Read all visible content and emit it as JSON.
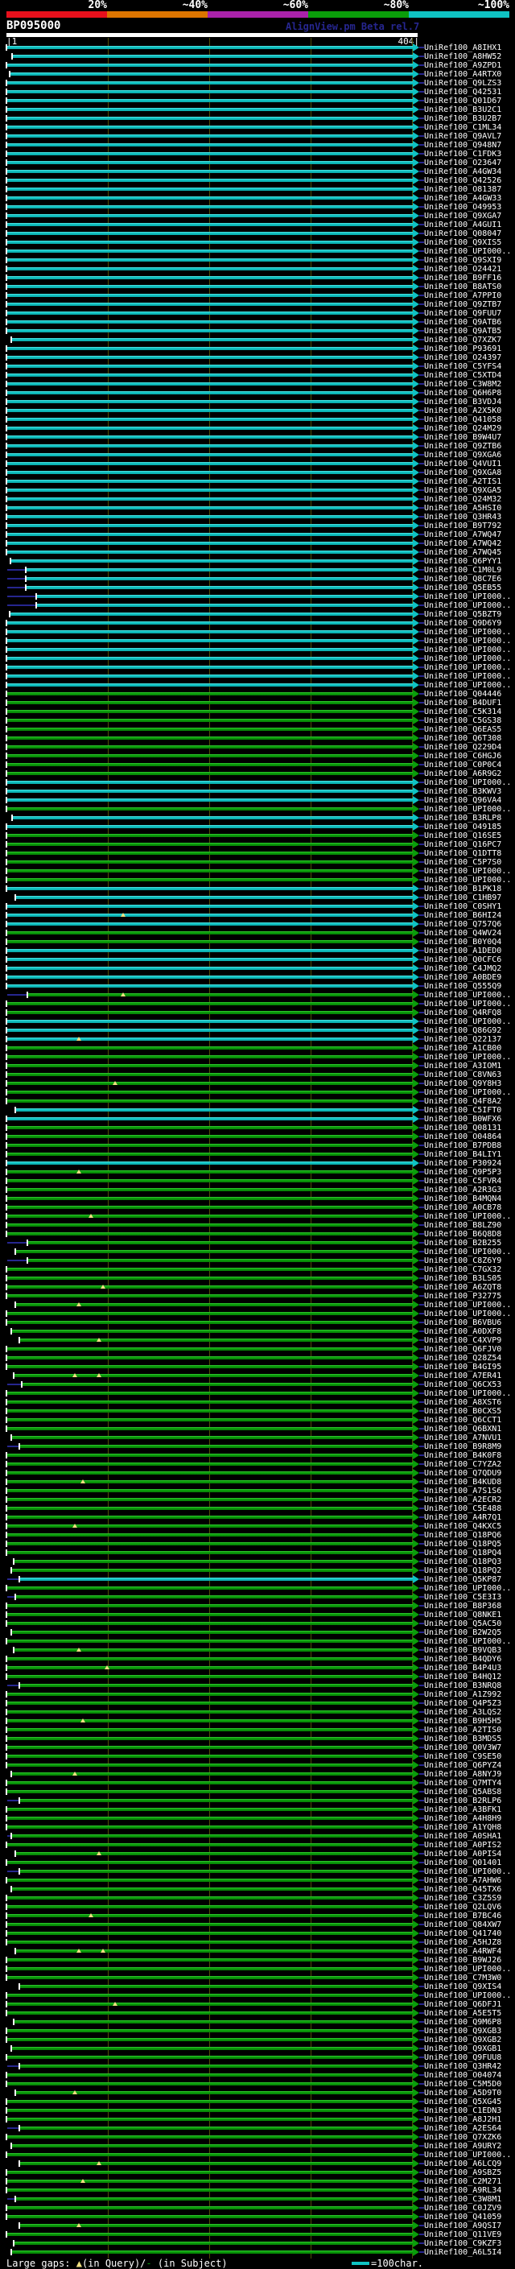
{
  "header": {
    "watermark": "AlignView.pm Beta rel.7",
    "key": {
      "labels": [
        "20%",
        "~40%",
        "~60%",
        "~80%",
        "~100%"
      ],
      "colors": [
        "#e8101c",
        "#dd7500",
        "#aa22aa",
        "#0a9e0a",
        "#0fc3c3"
      ]
    }
  },
  "legend": {
    "prefix": "Large gaps: ",
    "gap_query_symbol": "▲",
    "mid": "(in Query)/",
    "gap_subject_symbol": "-",
    "suffix": " (in Subject)",
    "scale_note": "=100char."
  },
  "colors": {
    "cyan": "#0fc3c3",
    "green": "#0a9e0a",
    "navy": "#26268f",
    "grid": "#4f4f08",
    "gap_marker": "#f0e080",
    "text": "#ffffff"
  },
  "label_prefix": "UniRef100_",
  "chart_data": {
    "type": "table",
    "title": "BP095000",
    "x_axis": {
      "start_label": "1",
      "end_label": "404",
      "tick_interval_chars": 100
    },
    "identity_key": {
      "bins": [
        "20%",
        "~40%",
        "~60%",
        "~80%",
        "~100%"
      ],
      "bin_colors": [
        "#e8101c",
        "#dd7500",
        "#aa22aa",
        "#0a9e0a",
        "#0fc3c3"
      ]
    },
    "row_format": "[uniref_id_suffix, identity_color(c=~100% cyan | g=~80% green), bar_start_px(default 9), navy_lead(1=subject extension line), gap_marker_x_px[]]",
    "rows": [
      [
        "A8IHX1",
        "c"
      ],
      [
        "A8HW52",
        "c",
        16
      ],
      [
        "A9ZPD1",
        "c"
      ],
      [
        "A4RTX0",
        "c",
        13
      ],
      [
        "Q9LZS3",
        "c"
      ],
      [
        "Q42531",
        "c"
      ],
      [
        "Q01D67",
        "c"
      ],
      [
        "B3U2C1",
        "c"
      ],
      [
        "B3U2B7",
        "c"
      ],
      [
        "C1ML34",
        "c"
      ],
      [
        "Q9AVL7",
        "c"
      ],
      [
        "Q948N7",
        "c"
      ],
      [
        "C1FDK3",
        "c"
      ],
      [
        "O23647",
        "c"
      ],
      [
        "A4GW34",
        "c"
      ],
      [
        "Q42526",
        "c"
      ],
      [
        "O81387",
        "c"
      ],
      [
        "A4GW33",
        "c"
      ],
      [
        "O49953",
        "c"
      ],
      [
        "Q9XGA7",
        "c"
      ],
      [
        "A4GUI1",
        "c"
      ],
      [
        "Q08047",
        "c"
      ],
      [
        "Q9XIS5",
        "c"
      ],
      [
        "UPI000..",
        "c"
      ],
      [
        "Q9SXI9",
        "c"
      ],
      [
        "O24421",
        "c"
      ],
      [
        "B9FF16",
        "c"
      ],
      [
        "B8ATS0",
        "c"
      ],
      [
        "A7PPI0",
        "c"
      ],
      [
        "Q9ZTB7",
        "c"
      ],
      [
        "Q9FUU7",
        "c"
      ],
      [
        "Q9ATB6",
        "c"
      ],
      [
        "Q9ATB5",
        "c"
      ],
      [
        "Q7XZK7",
        "c",
        15
      ],
      [
        "P93691",
        "c"
      ],
      [
        "O24397",
        "c"
      ],
      [
        "C5YFS4",
        "c"
      ],
      [
        "C5XTD4",
        "c"
      ],
      [
        "C3W8M2",
        "c"
      ],
      [
        "Q6H6P8",
        "c"
      ],
      [
        "B3VDJ4",
        "c"
      ],
      [
        "A2X5K0",
        "c"
      ],
      [
        "Q41058",
        "c"
      ],
      [
        "Q24M29",
        "c"
      ],
      [
        "B9W4U7",
        "c"
      ],
      [
        "Q9ZTB6",
        "c"
      ],
      [
        "Q9XGA6",
        "c"
      ],
      [
        "Q4VUI1",
        "c"
      ],
      [
        "Q9XGA8",
        "c"
      ],
      [
        "A2TIS1",
        "c"
      ],
      [
        "Q9XGA5",
        "c"
      ],
      [
        "Q24M32",
        "c"
      ],
      [
        "A5HSI0",
        "c"
      ],
      [
        "Q3HR43",
        "c"
      ],
      [
        "B9T792",
        "c"
      ],
      [
        "A7WQ47",
        "c"
      ],
      [
        "A7WQ42",
        "c"
      ],
      [
        "A7WQ45",
        "c"
      ],
      [
        "Q6PYY1",
        "c",
        14
      ],
      [
        "C1M0L9",
        "c",
        33,
        1
      ],
      [
        "Q8C7E6",
        "c",
        33,
        1
      ],
      [
        "Q5EB55",
        "c",
        33,
        1
      ],
      [
        "UPI000..",
        "c",
        46,
        1
      ],
      [
        "UPI000..",
        "c",
        46,
        1
      ],
      [
        "Q5BZT9",
        "c",
        13
      ],
      [
        "Q9D6Y9",
        "c"
      ],
      [
        "UPI000..",
        "c"
      ],
      [
        "UPI000..",
        "c"
      ],
      [
        "UPI000..",
        "c"
      ],
      [
        "UPI000..",
        "c"
      ],
      [
        "UPI000..",
        "c"
      ],
      [
        "UPI000..",
        "c"
      ],
      [
        "UPI000..",
        "c"
      ],
      [
        "Q04446",
        "g"
      ],
      [
        "B4DUF1",
        "g"
      ],
      [
        "C5K314",
        "g"
      ],
      [
        "C5GS38",
        "g"
      ],
      [
        "Q6EAS5",
        "g"
      ],
      [
        "Q6T308",
        "g"
      ],
      [
        "Q229D4",
        "g"
      ],
      [
        "C6HGJ6",
        "g"
      ],
      [
        "C0P0C4",
        "g"
      ],
      [
        "A6R9G2",
        "g"
      ],
      [
        "UPI000..",
        "c"
      ],
      [
        "B3KWV3",
        "c"
      ],
      [
        "Q96VA4",
        "c"
      ],
      [
        "UPI000..",
        "g"
      ],
      [
        "B3RLP8",
        "c",
        16
      ],
      [
        "O49185",
        "c"
      ],
      [
        "Q16SE5",
        "g"
      ],
      [
        "Q16PC7",
        "g"
      ],
      [
        "Q1DTT8",
        "g"
      ],
      [
        "C5P7S0",
        "g"
      ],
      [
        "UPI000..",
        "g"
      ],
      [
        "UPI000..",
        "g"
      ],
      [
        "B1PK18",
        "c"
      ],
      [
        "C1HB97",
        "c",
        20
      ],
      [
        "C0SHY1",
        "c"
      ],
      [
        "B6HI24",
        "c",
        9,
        0,
        [
          150
        ]
      ],
      [
        "Q757Q6",
        "c"
      ],
      [
        "Q4WV24",
        "g"
      ],
      [
        "B0Y0Q4",
        "g"
      ],
      [
        "A1DED0",
        "c"
      ],
      [
        "Q0CFC6",
        "c"
      ],
      [
        "C4JMQ2",
        "c"
      ],
      [
        "A0BDE9",
        "c"
      ],
      [
        "Q555Q9",
        "c"
      ],
      [
        "UPI000..",
        "g",
        35,
        1,
        [
          150
        ]
      ],
      [
        "UPI000..",
        "g"
      ],
      [
        "Q4RFQ8",
        "g"
      ],
      [
        "UPI000..",
        "c"
      ],
      [
        "Q86G92",
        "c"
      ],
      [
        "Q22137",
        "c",
        9,
        0,
        [
          95
        ]
      ],
      [
        "A1CB00",
        "g"
      ],
      [
        "UPI000..",
        "g"
      ],
      [
        "A3IOM1",
        "g"
      ],
      [
        "C8VN63",
        "g"
      ],
      [
        "Q9Y8H3",
        "g",
        9,
        0,
        [
          140
        ]
      ],
      [
        "UPI000..",
        "g"
      ],
      [
        "Q4F8A2",
        "g"
      ],
      [
        "C5IFT0",
        "c",
        20
      ],
      [
        "B0WFX6",
        "c"
      ],
      [
        "Q08131",
        "g"
      ],
      [
        "O04864",
        "g"
      ],
      [
        "B7PDB8",
        "g"
      ],
      [
        "B4LIY1",
        "g"
      ],
      [
        "P30924",
        "c"
      ],
      [
        "Q9P5P3",
        "g",
        9,
        0,
        [
          95
        ]
      ],
      [
        "C5FVR4",
        "g"
      ],
      [
        "A2R3G3",
        "g"
      ],
      [
        "B4MQN4",
        "g"
      ],
      [
        "A0CB78",
        "g"
      ],
      [
        "UPI000..",
        "g",
        9,
        0,
        [
          110
        ]
      ],
      [
        "B8LZ90",
        "g"
      ],
      [
        "B6Q8D8",
        "g"
      ],
      [
        "B2B255",
        "g",
        35,
        1
      ],
      [
        "UPI000..",
        "g",
        20
      ],
      [
        "C8Z6Y9",
        "g",
        35,
        1
      ],
      [
        "C7GX32",
        "g"
      ],
      [
        "B3LS05",
        "g"
      ],
      [
        "A6ZQT8",
        "g",
        9,
        0,
        [
          125
        ]
      ],
      [
        "P32775",
        "g"
      ],
      [
        "UPI000..",
        "g",
        20,
        0,
        [
          95
        ]
      ],
      [
        "UPI000..",
        "g"
      ],
      [
        "B6VBU6",
        "g"
      ],
      [
        "A0DXF8",
        "g",
        15
      ],
      [
        "C4XVP9",
        "g",
        25,
        0,
        [
          120
        ]
      ],
      [
        "Q6FJV0",
        "g"
      ],
      [
        "Q28Z54",
        "g"
      ],
      [
        "B4GI95",
        "g"
      ],
      [
        "A7ER41",
        "g",
        18,
        0,
        [
          90,
          120
        ]
      ],
      [
        "Q6CX53",
        "g",
        28,
        1
      ],
      [
        "UPI000..",
        "g"
      ],
      [
        "A8XST6",
        "g"
      ],
      [
        "B0CXS5",
        "g"
      ],
      [
        "Q6CCT1",
        "g"
      ],
      [
        "Q6BXN1",
        "g"
      ],
      [
        "A7NVU1",
        "g",
        15
      ],
      [
        "B9R8M9",
        "g",
        25,
        1
      ],
      [
        "B4K0F8",
        "g"
      ],
      [
        "C7YZA2",
        "g"
      ],
      [
        "Q7QDU9",
        "g"
      ],
      [
        "B4KUD8",
        "g",
        9,
        0,
        [
          100
        ]
      ],
      [
        "A7S1S6",
        "g"
      ],
      [
        "A2ECR2",
        "g"
      ],
      [
        "C5E488",
        "g"
      ],
      [
        "A4R7Q1",
        "g"
      ],
      [
        "Q4KXC5",
        "g",
        9,
        0,
        [
          90
        ]
      ],
      [
        "Q18PQ6",
        "g"
      ],
      [
        "Q18PQ5",
        "g"
      ],
      [
        "Q18PQ4",
        "g"
      ],
      [
        "Q18PQ3",
        "g",
        18
      ],
      [
        "Q18PQ2",
        "g",
        15
      ],
      [
        "Q5KP87",
        "c",
        25,
        1
      ],
      [
        "UPI000..",
        "g"
      ],
      [
        "C5E3I3",
        "g",
        20,
        1
      ],
      [
        "B8P368",
        "g"
      ],
      [
        "Q8NKE1",
        "g"
      ],
      [
        "Q5AC50",
        "g"
      ],
      [
        "B2W2Q5",
        "g",
        15
      ],
      [
        "UPI000..",
        "g"
      ],
      [
        "B9VQB3",
        "g",
        18,
        0,
        [
          95
        ]
      ],
      [
        "B4QDY6",
        "g"
      ],
      [
        "B4P4U3",
        "g",
        9,
        0,
        [
          130
        ]
      ],
      [
        "B4HQ12",
        "g"
      ],
      [
        "B3NRQ8",
        "g",
        25,
        1
      ],
      [
        "A1Z992",
        "g"
      ],
      [
        "Q4P5Z3",
        "g"
      ],
      [
        "A3LQS2",
        "g"
      ],
      [
        "B9H5H5",
        "g",
        9,
        0,
        [
          100
        ]
      ],
      [
        "A2TIS0",
        "g"
      ],
      [
        "B3MDS5",
        "g"
      ],
      [
        "Q0V3W7",
        "g"
      ],
      [
        "C9SE50",
        "g"
      ],
      [
        "Q6PYZ4",
        "g"
      ],
      [
        "A8NYJ9",
        "g",
        15,
        0,
        [
          90
        ]
      ],
      [
        "Q7MTY4",
        "g"
      ],
      [
        "Q5ABS8",
        "g"
      ],
      [
        "B2RLP6",
        "g",
        25,
        1
      ],
      [
        "A3BFK1",
        "g"
      ],
      [
        "A4H8H9",
        "g"
      ],
      [
        "A1YQH8",
        "g"
      ],
      [
        "A0SHA1",
        "g",
        15,
        1
      ],
      [
        "A0PIS2",
        "g"
      ],
      [
        "A0PIS4",
        "g",
        20,
        0,
        [
          120
        ]
      ],
      [
        "Q01401",
        "g"
      ],
      [
        "UPI000..",
        "g",
        25,
        1
      ],
      [
        "A7AHW6",
        "g"
      ],
      [
        "Q45TX6",
        "g",
        15
      ],
      [
        "C3Z5S9",
        "g"
      ],
      [
        "Q2LQV6",
        "g"
      ],
      [
        "B7BC46",
        "g",
        9,
        0,
        [
          110
        ]
      ],
      [
        "Q84XW7",
        "g"
      ],
      [
        "Q41740",
        "g"
      ],
      [
        "A5HJZ8",
        "g"
      ],
      [
        "A4RWF4",
        "g",
        20,
        0,
        [
          95,
          125
        ]
      ],
      [
        "B9WJ26",
        "g"
      ],
      [
        "UPI000..",
        "g"
      ],
      [
        "C7M3W0",
        "g"
      ],
      [
        "Q9XIS4",
        "g",
        25
      ],
      [
        "UPI000..",
        "g"
      ],
      [
        "Q6DFJ1",
        "g",
        9,
        0,
        [
          140
        ]
      ],
      [
        "A5E5T5",
        "g"
      ],
      [
        "Q9M6P8",
        "g",
        18
      ],
      [
        "Q9XGB3",
        "g"
      ],
      [
        "Q9XGB2",
        "g"
      ],
      [
        "Q9XGB1",
        "g",
        15
      ],
      [
        "Q9FUU8",
        "g"
      ],
      [
        "Q3HR42",
        "g",
        25,
        1
      ],
      [
        "O04074",
        "g"
      ],
      [
        "C5M5D0",
        "g"
      ],
      [
        "A5D9T0",
        "g",
        20,
        0,
        [
          90
        ]
      ],
      [
        "Q5XG45",
        "g"
      ],
      [
        "C1EDN3",
        "g"
      ],
      [
        "A8J2H1",
        "g"
      ],
      [
        "A2ES64",
        "g",
        25,
        1
      ],
      [
        "Q7XZK6",
        "g"
      ],
      [
        "A9URY2",
        "g",
        15
      ],
      [
        "UPI000..",
        "g"
      ],
      [
        "A6LCQ9",
        "g",
        25,
        0,
        [
          120
        ]
      ],
      [
        "A9SBZ5",
        "g"
      ],
      [
        "C2M271",
        "g",
        9,
        0,
        [
          100
        ]
      ],
      [
        "A9RL34",
        "g"
      ],
      [
        "C3W8M1",
        "g",
        20,
        1
      ],
      [
        "C0JZV9",
        "g"
      ],
      [
        "Q41059",
        "g"
      ],
      [
        "A9QSI7",
        "g",
        25,
        0,
        [
          95
        ]
      ],
      [
        "Q11VE9",
        "g"
      ],
      [
        "C9KZF3",
        "g",
        18
      ],
      [
        "A6L5I4",
        "g",
        15
      ]
    ]
  }
}
